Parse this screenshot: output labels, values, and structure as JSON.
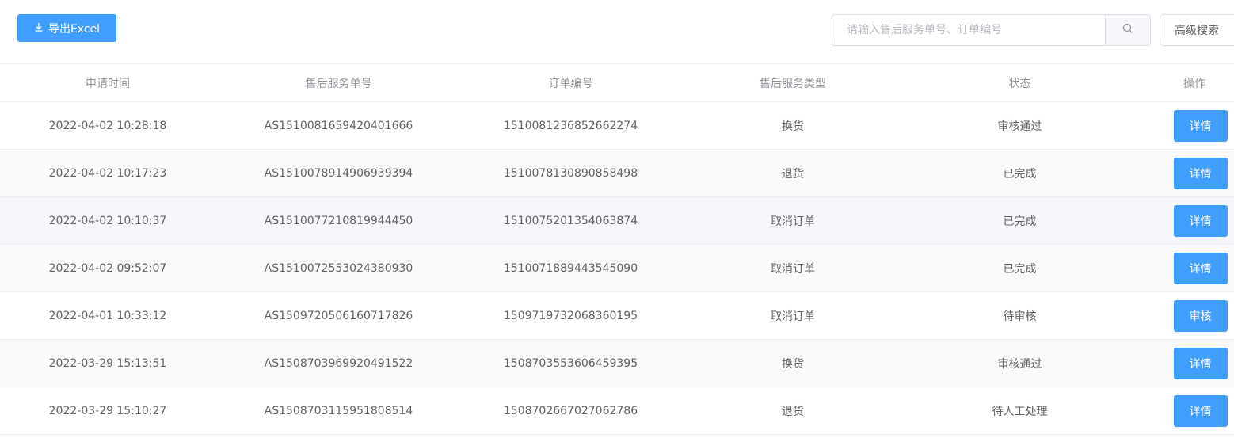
{
  "toolbar": {
    "export_label": "导出Excel",
    "search_placeholder": "请输入售后服务单号、订单编号",
    "advanced_search_label": "高级搜索"
  },
  "table": {
    "headers": [
      "申请时间",
      "售后服务单号",
      "订单编号",
      "售后服务类型",
      "状态",
      "操作"
    ],
    "rows": [
      {
        "time": "2022-04-02 10:28:18",
        "service_no": "AS1510081659420401666",
        "order_no": "1510081236852662274",
        "type": "换货",
        "status": "审核通过",
        "action": "详情"
      },
      {
        "time": "2022-04-02 10:17:23",
        "service_no": "AS1510078914906939394",
        "order_no": "1510078130890858498",
        "type": "退货",
        "status": "已完成",
        "action": "详情"
      },
      {
        "time": "2022-04-02 10:10:37",
        "service_no": "AS1510077210819944450",
        "order_no": "1510075201354063874",
        "type": "取消订单",
        "status": "已完成",
        "action": "详情"
      },
      {
        "time": "2022-04-02 09:52:07",
        "service_no": "AS1510072553024380930",
        "order_no": "1510071889443545090",
        "type": "取消订单",
        "status": "已完成",
        "action": "详情"
      },
      {
        "time": "2022-04-01 10:33:12",
        "service_no": "AS1509720506160717826",
        "order_no": "1509719732068360195",
        "type": "取消订单",
        "status": "待审核",
        "action": "审核"
      },
      {
        "time": "2022-03-29 15:13:51",
        "service_no": "AS1508703969920491522",
        "order_no": "1508703553606459395",
        "type": "换货",
        "status": "审核通过",
        "action": "详情"
      },
      {
        "time": "2022-03-29 15:10:27",
        "service_no": "AS1508703115951808514",
        "order_no": "1508702667027062786",
        "type": "退货",
        "status": "待人工处理",
        "action": "详情"
      }
    ]
  },
  "icons": {
    "export": "download-icon",
    "search": "search-icon"
  },
  "colors": {
    "primary": "#409eff",
    "header_text": "#909399",
    "body_text": "#606266",
    "border": "#ebeef5"
  }
}
